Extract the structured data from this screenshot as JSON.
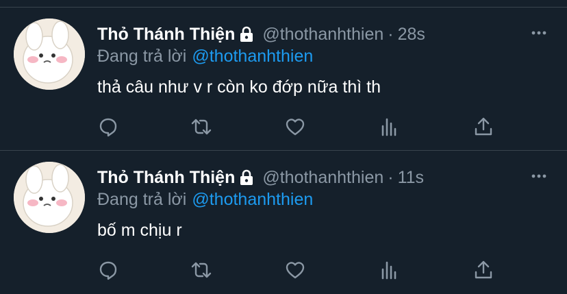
{
  "colors": {
    "background": "#15202b",
    "divider": "#38444d",
    "secondary_text": "#8b98a5",
    "accent": "#1d9bf0",
    "primary_text": "#ffffff"
  },
  "tweets": [
    {
      "display_name": "Thỏ Thánh Thiện",
      "handle": "@thothanhthien",
      "separator": "·",
      "time": "28s",
      "reply_prefix": "Đang trả lời",
      "reply_to": "@thothanhthien",
      "text": "thả câu như v r còn ko đớp nữa thì th",
      "icons": [
        "lock-icon",
        "more-icon",
        "reply-icon",
        "retweet-icon",
        "like-icon",
        "views-icon",
        "share-icon"
      ]
    },
    {
      "display_name": "Thỏ Thánh Thiện",
      "handle": "@thothanhthien",
      "separator": "·",
      "time": "11s",
      "reply_prefix": "Đang trả lời",
      "reply_to": "@thothanhthien",
      "text": "bố m chịu r",
      "icons": [
        "lock-icon",
        "more-icon",
        "reply-icon",
        "retweet-icon",
        "like-icon",
        "views-icon",
        "share-icon"
      ]
    }
  ]
}
